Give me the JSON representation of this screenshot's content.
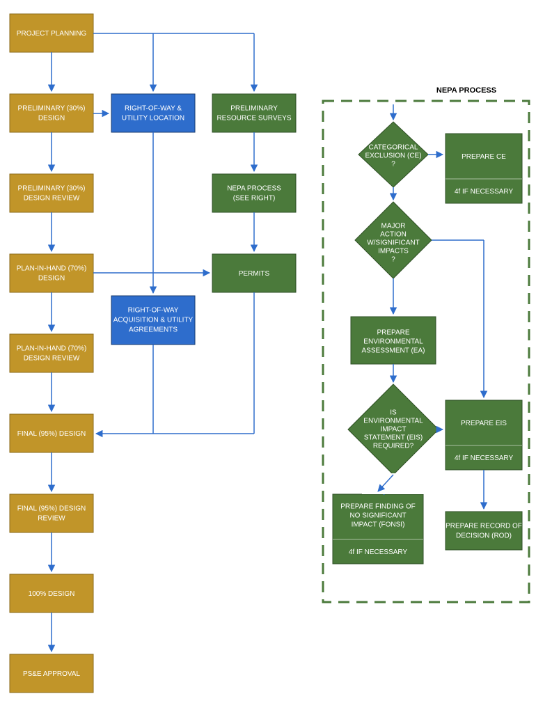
{
  "boxes": {
    "b1": "PROJECT PLANNING",
    "b2": "PRELIMINARY (30%) DESIGN",
    "b3": "PRELIMINARY (30%) DESIGN REVIEW",
    "b4": "PLAN-IN-HAND (70%) DESIGN",
    "b5": "PLAN-IN-HAND (70%) DESIGN REVIEW",
    "b6": "FINAL (95%) DESIGN",
    "b7": "FINAL (95%) DESIGN REVIEW",
    "b8": "100% DESIGN",
    "b9": "PS&E APPROVAL",
    "row1a": "RIGHT-OF-WAY & UTILITY LOCATION",
    "row2a": "RIGHT-OF-WAY ACQUISITION & UTILITY AGREEMENTS",
    "surv": "PRELIMINARY RESOURCE SURVEYS",
    "nepa": "NEPA PROCESS (SEE RIGHT)",
    "perm": "PERMITS",
    "d1": "CATEGORICAL EXCLUSION (CE) ?",
    "d2": "MAJOR ACTION W/SIGNIFICANT IMPACTS ?",
    "ea": "PREPARE ENVIRONMENTAL ASSESSMENT (EA)",
    "d3": "IS ENVIRONMENTAL IMPACT STATEMENT (EIS) REQUIRED?",
    "fonsi_top": "PREPARE FINDING OF NO SIGNIFICANT IMPACT (FONSI)",
    "fonsi_bot": "4f IF NECESSARY",
    "ce_top": "PREPARE CE",
    "ce_bot": "4f IF NECESSARY",
    "eis_top": "PREPARE EIS",
    "eis_bot": "4f IF NECESSARY",
    "rod": "PREPARE RECORD OF DECISION (ROD)"
  },
  "section_title": "NEPA PROCESS",
  "colors": {
    "gold": "#c19529",
    "blue": "#2e6dcc",
    "green": "#4b7a3b"
  }
}
